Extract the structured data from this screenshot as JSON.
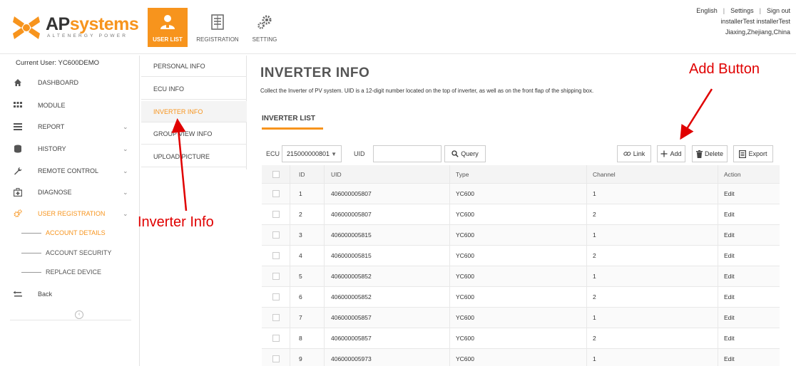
{
  "header": {
    "logo": {
      "brand_a": "AP",
      "brand_b": "systems",
      "tagline": "ALTENERGY POWER"
    },
    "nav": [
      {
        "label": "USER LIST",
        "active": true,
        "icon": "user-list-icon"
      },
      {
        "label": "REGISTRATION",
        "active": false,
        "icon": "registration-icon"
      },
      {
        "label": "SETTING",
        "active": false,
        "icon": "setting-icon"
      }
    ],
    "top_links": {
      "language": "English",
      "settings": "Settings",
      "sign_out": "Sign out",
      "separator": "|"
    },
    "user_name": "installerTest installerTest",
    "user_location": "Jiaxing,Zhejiang,China"
  },
  "sidebar": {
    "current_user": "Current User: YC600DEMO",
    "items": [
      {
        "label": "DASHBOARD",
        "icon": "home-icon",
        "has_chevron": false,
        "active": false
      },
      {
        "label": "MODULE",
        "icon": "grid-icon",
        "has_chevron": false,
        "active": false
      },
      {
        "label": "REPORT",
        "icon": "report-icon",
        "has_chevron": true,
        "active": false
      },
      {
        "label": "HISTORY",
        "icon": "database-icon",
        "has_chevron": true,
        "active": false
      },
      {
        "label": "REMOTE CONTROL",
        "icon": "wrench-icon",
        "has_chevron": true,
        "active": false
      },
      {
        "label": "DIAGNOSE",
        "icon": "medical-kit-icon",
        "has_chevron": true,
        "active": false
      },
      {
        "label": "USER REGISTRATION",
        "icon": "gears-icon",
        "has_chevron": true,
        "active": true
      }
    ],
    "sub_items": [
      {
        "label": "ACCOUNT DETAILS",
        "active": true
      },
      {
        "label": "ACCOUNT SECURITY",
        "active": false
      },
      {
        "label": "REPLACE DEVICE",
        "active": false
      }
    ],
    "back": "Back",
    "chevron": "⌄",
    "collapse": "‹"
  },
  "submenu": {
    "items": [
      {
        "label": "PERSONAL INFO",
        "active": false
      },
      {
        "label": "ECU INFO",
        "active": false
      },
      {
        "label": "INVERTER INFO",
        "active": true
      },
      {
        "label": "GROUP VIEW INFO",
        "active": false
      },
      {
        "label": "UPLOAD PICTURE",
        "active": false
      }
    ]
  },
  "main": {
    "title": "INVERTER INFO",
    "description": "Collect the Inverter of PV system. UID is a 12-digit number located on the top of inverter, as well as on the front flap of the shipping box.",
    "list_tab": "INVERTER LIST",
    "toolbar": {
      "ecu_label": "ECU",
      "ecu_value": "215000000801",
      "ecu_caret": "▼",
      "uid_label": "UID",
      "uid_value": "",
      "query": "Query",
      "link": "Link",
      "add": "Add",
      "delete": "Delete",
      "export": "Export"
    },
    "table": {
      "columns": [
        "ID",
        "UID",
        "Type",
        "Channel",
        "Action"
      ],
      "rows": [
        {
          "id": "1",
          "uid": "406000005807",
          "type": "YC600",
          "channel": "1",
          "action": "Edit"
        },
        {
          "id": "2",
          "uid": "406000005807",
          "type": "YC600",
          "channel": "2",
          "action": "Edit"
        },
        {
          "id": "3",
          "uid": "406000005815",
          "type": "YC600",
          "channel": "1",
          "action": "Edit"
        },
        {
          "id": "4",
          "uid": "406000005815",
          "type": "YC600",
          "channel": "2",
          "action": "Edit"
        },
        {
          "id": "5",
          "uid": "406000005852",
          "type": "YC600",
          "channel": "1",
          "action": "Edit"
        },
        {
          "id": "6",
          "uid": "406000005852",
          "type": "YC600",
          "channel": "2",
          "action": "Edit"
        },
        {
          "id": "7",
          "uid": "406000005857",
          "type": "YC600",
          "channel": "1",
          "action": "Edit"
        },
        {
          "id": "8",
          "uid": "406000005857",
          "type": "YC600",
          "channel": "2",
          "action": "Edit"
        },
        {
          "id": "9",
          "uid": "406000005973",
          "type": "YC600",
          "channel": "1",
          "action": "Edit"
        }
      ]
    }
  },
  "annotations": {
    "inverter_info": "Inverter Info",
    "add_button": "Add Button",
    "color": "#e00000"
  },
  "colors": {
    "accent": "#f7941d",
    "annotation": "#e00000"
  }
}
